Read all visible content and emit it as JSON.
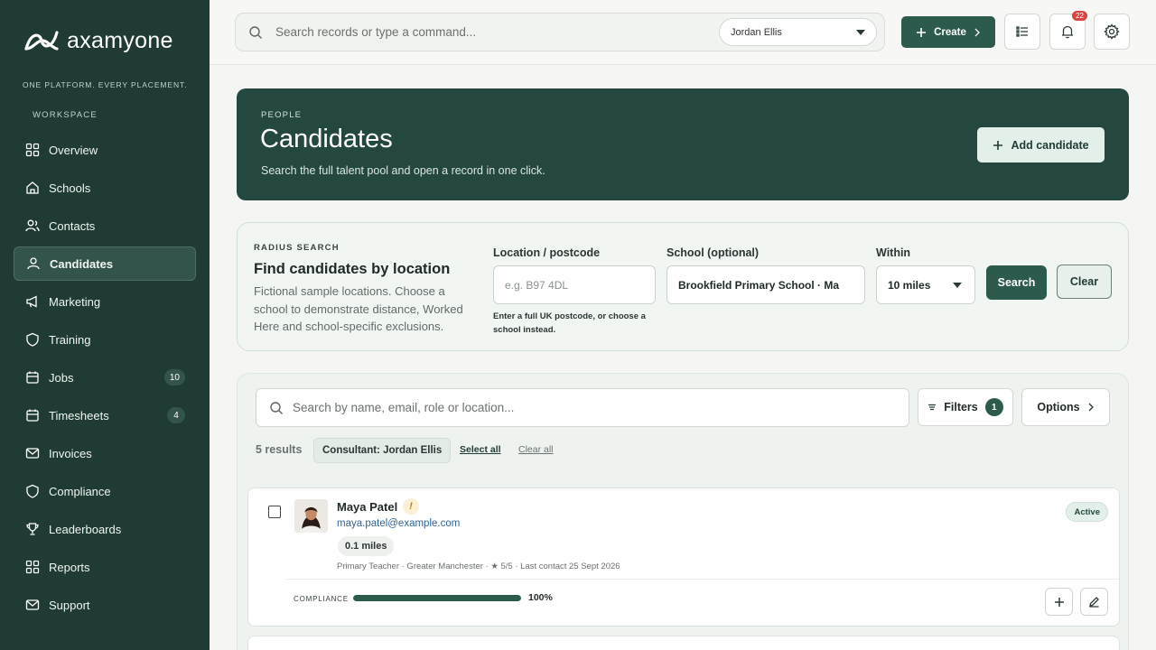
{
  "brand": {
    "name": "axamyone",
    "tagline": "ONE PLATFORM. EVERY PLACEMENT."
  },
  "sidebar": {
    "section": "WORKSPACE",
    "items": [
      {
        "label": "Overview",
        "icon": "grid-icon"
      },
      {
        "label": "Schools",
        "icon": "school-icon"
      },
      {
        "label": "Contacts",
        "icon": "contacts-icon"
      },
      {
        "label": "Candidates",
        "icon": "user-icon",
        "active": true
      },
      {
        "label": "Marketing",
        "icon": "megaphone-icon"
      },
      {
        "label": "Training",
        "icon": "shield-icon"
      },
      {
        "label": "Jobs",
        "icon": "calendar-icon",
        "badge": "10"
      },
      {
        "label": "Timesheets",
        "icon": "calendar-icon",
        "badge": "4"
      },
      {
        "label": "Invoices",
        "icon": "mail-icon"
      },
      {
        "label": "Compliance",
        "icon": "shield-icon"
      },
      {
        "label": "Leaderboards",
        "icon": "trophy-icon"
      },
      {
        "label": "Reports",
        "icon": "grid-icon"
      },
      {
        "label": "Support",
        "icon": "mail-icon"
      }
    ]
  },
  "topbar": {
    "search_placeholder": "Search records or type a command...",
    "user": "Jordan Ellis",
    "create_label": "Create",
    "notifications": "22"
  },
  "hero": {
    "eyebrow": "PEOPLE",
    "title": "Candidates",
    "subtitle": "Search the full talent pool and open a record in one click.",
    "add_label": "Add candidate"
  },
  "radius": {
    "eyebrow": "RADIUS SEARCH",
    "title": "Find candidates by location",
    "description": "Fictional sample locations. Choose a school to demonstrate distance, Worked Here and school-specific exclusions.",
    "location_label": "Location / postcode",
    "location_placeholder": "e.g. B97 4DL",
    "hint": "Enter a full UK postcode, or choose a school instead.",
    "school_label": "School (optional)",
    "school_value": "Brookfield Primary School · Ma",
    "within_label": "Within",
    "within_value": "10 miles",
    "search_label": "Search",
    "clear_label": "Clear"
  },
  "results": {
    "search_placeholder": "Search by name, email, role or location...",
    "filters_label": "Filters",
    "filters_count": "1",
    "options_label": "Options",
    "count": "5 results",
    "chip": "Consultant: Jordan Ellis",
    "select_all": "Select all",
    "clear_all": "Clear all",
    "candidates": [
      {
        "name": "Maya Patel",
        "flag": "!",
        "email": "maya.patel@example.com",
        "distance": "0.1 miles",
        "meta": "Primary Teacher · Greater Manchester · ★ 5/5 · Last contact 25 Sept 2026",
        "status": "Active",
        "compliance_label": "COMPLIANCE",
        "compliance_pct": "100%",
        "compliance_value": 100
      }
    ]
  },
  "colors": {
    "brand": "#1f3b34",
    "accent": "#2c5a4d",
    "warning": "#b88400",
    "link": "#2d6496"
  }
}
